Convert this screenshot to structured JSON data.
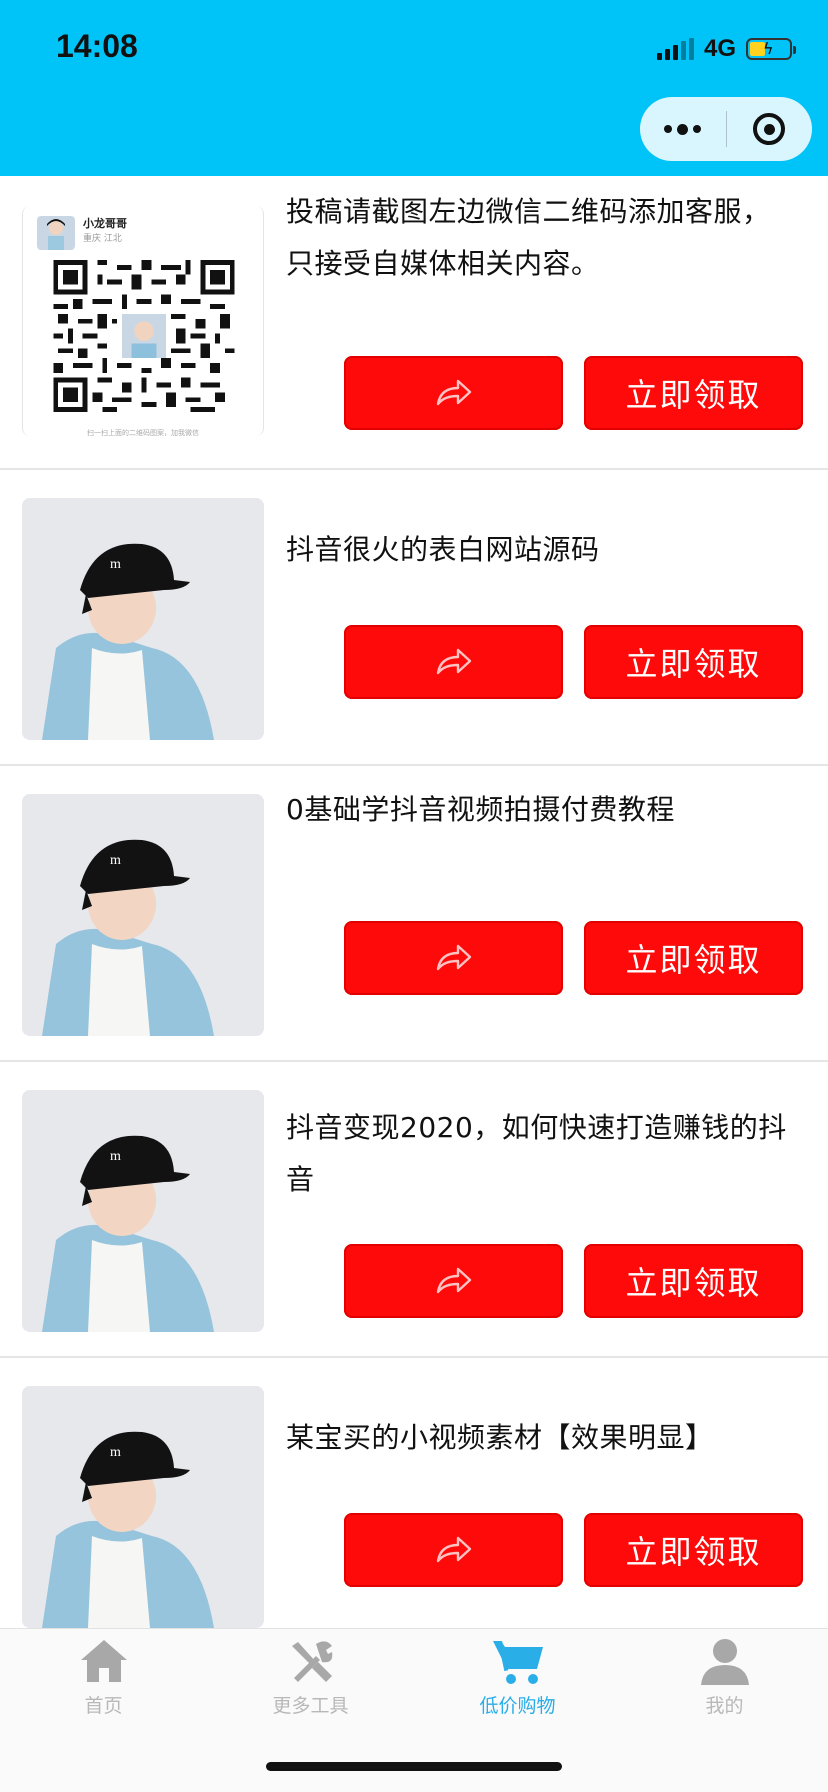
{
  "status_bar": {
    "time": "14:08",
    "network": "4G",
    "battery_level": 0.4,
    "battery_color": "#ffd21f"
  },
  "header": {
    "background_color": "#00c3f7",
    "capsule_icons": [
      "more-dots-icon",
      "close-target-icon"
    ]
  },
  "qr_card": {
    "name": "小龙哥哥",
    "location": "重庆 江北",
    "footer": "扫一扫上面的二维码图案，加我微信"
  },
  "items": [
    {
      "title": "投稿请截图左边微信二维码添加客服，只接受自媒体相关内容。",
      "share_icon": "share-arrow-icon",
      "claim_label": "立即领取",
      "thumb": "qr-code"
    },
    {
      "title": "抖音很火的表白网站源码",
      "share_icon": "share-arrow-icon",
      "claim_label": "立即领取",
      "thumb": "boy-photo"
    },
    {
      "title": "0基础学抖音视频拍摄付费教程",
      "share_icon": "share-arrow-icon",
      "claim_label": "立即领取",
      "thumb": "boy-photo"
    },
    {
      "title": "抖音变现2020，如何快速打造赚钱的抖音",
      "share_icon": "share-arrow-icon",
      "claim_label": "立即领取",
      "thumb": "boy-photo"
    },
    {
      "title": "某宝买的小视频素材【效果明显】",
      "share_icon": "share-arrow-icon",
      "claim_label": "立即领取",
      "thumb": "boy-photo"
    }
  ],
  "button_color": "#ff0a0a",
  "tabbar": {
    "tabs": [
      {
        "label": "首页",
        "icon": "home-icon",
        "active": false
      },
      {
        "label": "更多工具",
        "icon": "tools-icon",
        "active": false
      },
      {
        "label": "低价购物",
        "icon": "cart-icon",
        "active": true
      },
      {
        "label": "我的",
        "icon": "user-icon",
        "active": false
      }
    ],
    "active_color": "#2aaee8"
  }
}
